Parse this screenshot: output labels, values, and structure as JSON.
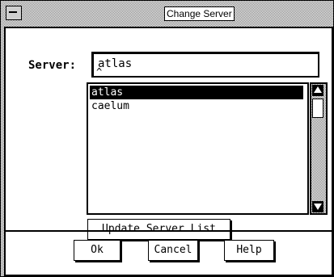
{
  "window": {
    "title": "Change Server"
  },
  "form": {
    "server_label": "Server:",
    "server_value": "atlas"
  },
  "server_list": {
    "items": [
      {
        "label": "atlas",
        "selected": true
      },
      {
        "label": "caelum",
        "selected": false
      }
    ]
  },
  "buttons": {
    "update": "Update Server List",
    "ok": "Ok",
    "cancel": "Cancel",
    "help": "Help"
  },
  "icons": {
    "system_menu": "system-menu-icon",
    "scroll_up": "arrow-up-icon",
    "scroll_down": "arrow-down-icon",
    "text_cursor": "caret-icon"
  },
  "colors": {
    "selection_bg": "#000000",
    "selection_fg": "#ffffff",
    "frame": "#7a7a7a"
  }
}
